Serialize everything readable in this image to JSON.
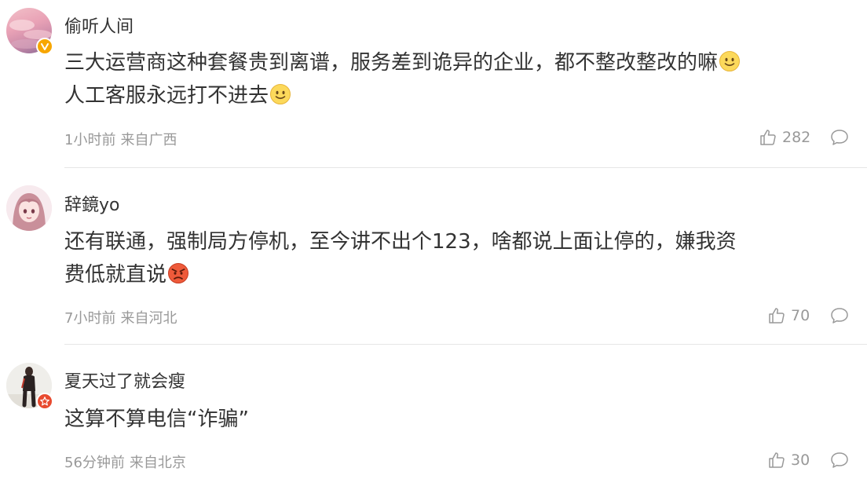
{
  "comments": [
    {
      "username": "偷听人间",
      "content_line1": "三大运营商这种套餐贵到离谱，服务差到诡异的企业，都不整改整改的嘛",
      "content_line2": "人工客服永远打不进去",
      "time": "1小时前",
      "location": "来自广西",
      "likes": "282",
      "badge": "v-verified-badge",
      "emojis": [
        "smile-emoji",
        "smile-emoji"
      ]
    },
    {
      "username": "辞鏡yo",
      "content_line1": "还有联通，强制局方停机，至今讲不出个123，啥都说上面让停的，嫌我资",
      "content_line2": "费低就直说",
      "time": "7小时前",
      "location": "来自河北",
      "likes": "70",
      "emojis": [
        "angry-emoji"
      ]
    },
    {
      "username": "夏天过了就会瘦",
      "content_line1": "这算不算电信“诈骗”",
      "time": "56分钟前",
      "location": "来自北京",
      "likes": "30",
      "badge": "star-badge"
    }
  ],
  "colors": {
    "text": "#333333",
    "meta": "#999999",
    "divider": "#e6e6e6",
    "v_badge": "#f7a600",
    "star_badge": "#e84a2f"
  }
}
